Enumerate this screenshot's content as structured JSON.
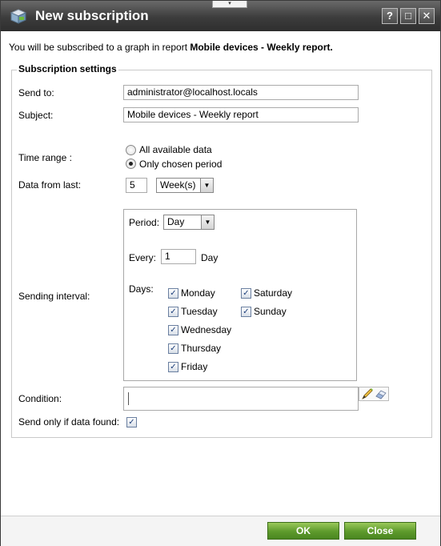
{
  "window": {
    "title": "New subscription",
    "controls": [
      "?",
      "□",
      "✕"
    ],
    "drag_handle": "▾"
  },
  "intro": {
    "prefix": "You will be subscribed to a graph in report ",
    "report": "Mobile devices - Weekly report."
  },
  "settings": {
    "legend": "Subscription settings",
    "send_to": {
      "label": "Send to:",
      "value": "administrator@localhost.locals"
    },
    "subject": {
      "label": "Subject:",
      "value": "Mobile devices - Weekly report"
    },
    "time_range": {
      "label": "Time range :",
      "options": [
        {
          "label": "All available data",
          "selected": false
        },
        {
          "label": "Only chosen period",
          "selected": true
        }
      ]
    },
    "data_from_last": {
      "label": "Data from last:",
      "value": "5",
      "unit": "Week(s)"
    },
    "sending_interval": {
      "label": "Sending interval:",
      "period": {
        "label": "Period:",
        "value": "Day"
      },
      "every": {
        "label": "Every:",
        "value": "1",
        "unit": "Day"
      },
      "days": {
        "label": "Days:",
        "items": [
          {
            "label": "Monday",
            "checked": true
          },
          {
            "label": "Tuesday",
            "checked": true
          },
          {
            "label": "Wednesday",
            "checked": true
          },
          {
            "label": "Thursday",
            "checked": true
          },
          {
            "label": "Friday",
            "checked": true
          },
          {
            "label": "Saturday",
            "checked": true
          },
          {
            "label": "Sunday",
            "checked": true
          }
        ]
      }
    },
    "condition": {
      "label": "Condition:",
      "value": ""
    },
    "send_only_if_found": {
      "label": "Send only if data found:",
      "checked": true
    }
  },
  "footer": {
    "ok": "OK",
    "close": "Close"
  },
  "colors": {
    "titlebar": "#3c3c3c",
    "button_green": "#5d9a2c"
  }
}
